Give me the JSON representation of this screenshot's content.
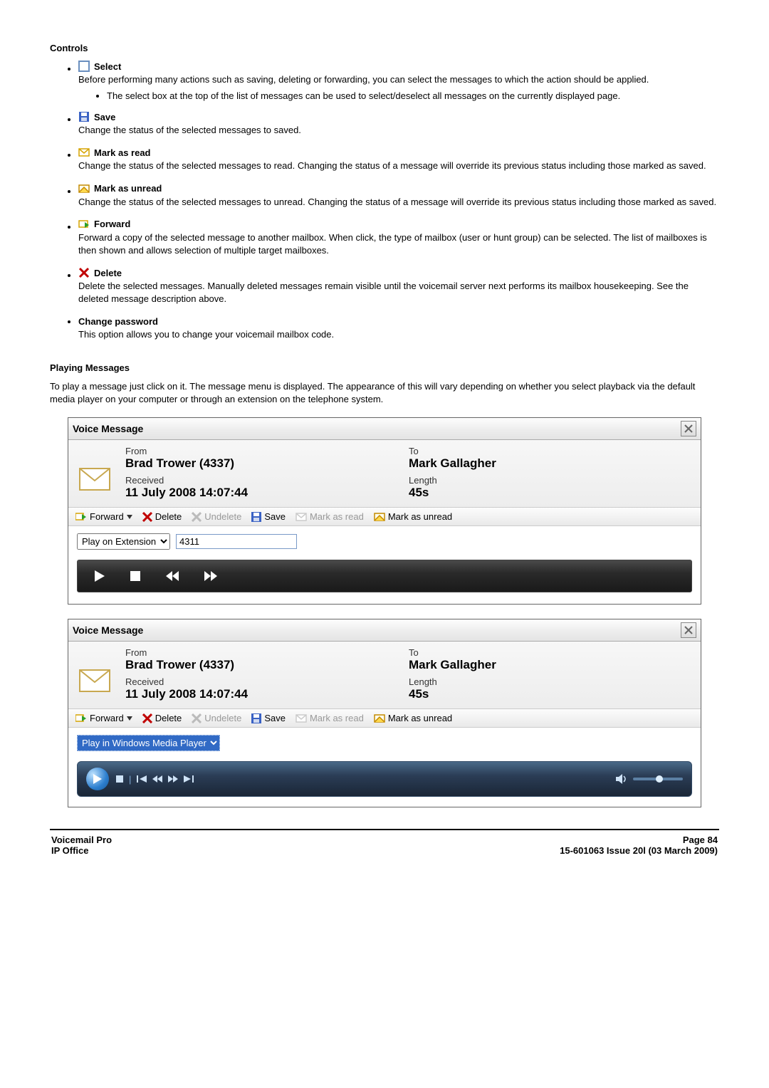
{
  "headings": {
    "controls": "Controls",
    "playing": "Playing Messages"
  },
  "controls": {
    "select": {
      "label": "Select",
      "desc": "Before performing many actions such as saving, deleting or forwarding, you can select the messages to which the action should be applied.",
      "sub1": "The select box at the top of the list of messages can be used to select/deselect all messages on the currently displayed page."
    },
    "save": {
      "label": "Save",
      "desc": "Change the status of the selected messages to saved."
    },
    "mark_read": {
      "label": "Mark as read",
      "desc": "Change the status of the selected messages to read. Changing the status of a message will override its previous status including those marked as saved."
    },
    "mark_unread": {
      "label": "Mark as unread",
      "desc": "Change the status of the selected messages to unread. Changing the status of a message will override its previous status including those marked as saved."
    },
    "forward": {
      "label": "Forward",
      "desc": "Forward a copy of the selected message to another mailbox. When click, the type of mailbox (user or hunt group) can be selected. The list of mailboxes is then shown and allows selection of multiple target mailboxes."
    },
    "delete": {
      "label": "Delete",
      "desc": "Delete the selected messages. Manually deleted messages remain visible until the voicemail server next performs its mailbox housekeeping. See the deleted message description above."
    },
    "change_pw": {
      "label": "Change password",
      "desc": "This option allows you to change your voicemail mailbox code."
    }
  },
  "playing_intro": "To play a message just click on it. The message menu is displayed. The appearance of this will vary depending on whether you select playback via the default media player on your computer or through an extension on the telephone system.",
  "vm": {
    "title": "Voice Message",
    "from_label": "From",
    "to_label": "To",
    "received_label": "Received",
    "length_label": "Length",
    "from_value": "Brad Trower (4337)",
    "to_value": "Mark Gallagher",
    "received_value": "11 July 2008 14:07:44",
    "length_value": "45s",
    "tb": {
      "forward": "Forward",
      "delete": "Delete",
      "undelete": "Undelete",
      "save": "Save",
      "mark_read": "Mark as read",
      "mark_unread": "Mark as unread"
    },
    "play_ext_label": "Play on Extension",
    "ext_value": "4311",
    "play_wmp_label": "Play in Windows Media Player"
  },
  "footer": {
    "left1": "Voicemail Pro",
    "left2": "IP Office",
    "right1": "Page 84",
    "right2": "15-601063 Issue 20l (03 March 2009)"
  }
}
